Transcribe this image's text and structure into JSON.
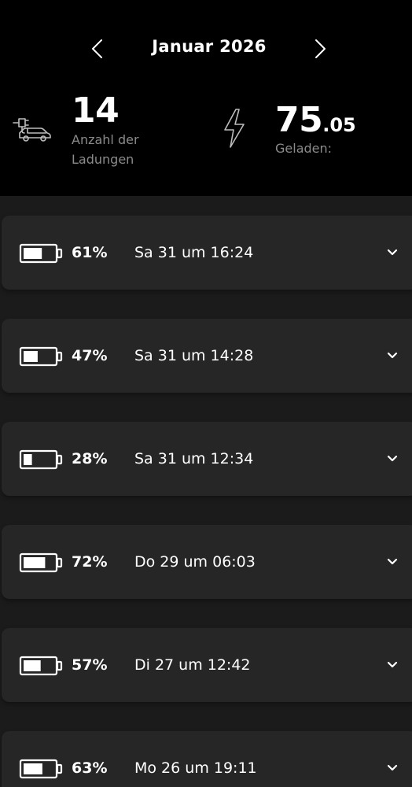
{
  "header": {
    "month_title": "Januar 2026",
    "prev_icon": "chevron-left-icon",
    "next_icon": "chevron-right-icon"
  },
  "stats": {
    "charges_count": "14",
    "charges_label": "Anzahl der Ladungen",
    "charges_icon": "ev-car-plug-icon",
    "energy_value_int": "75",
    "energy_value_dec": ".05",
    "energy_label": "Geladen:",
    "energy_icon": "lightning-bolt-icon"
  },
  "sessions": [
    {
      "percent": "61%",
      "level": 0.61,
      "datetime": "Sa 31 um 16:24"
    },
    {
      "percent": "47%",
      "level": 0.47,
      "datetime": "Sa 31 um 14:28"
    },
    {
      "percent": "28%",
      "level": 0.28,
      "datetime": "Sa 31 um 12:34"
    },
    {
      "percent": "72%",
      "level": 0.72,
      "datetime": "Do 29 um 06:03"
    },
    {
      "percent": "57%",
      "level": 0.57,
      "datetime": "Di 27 um 12:42"
    },
    {
      "percent": "63%",
      "level": 0.63,
      "datetime": "Mo 26 um 19:11"
    }
  ],
  "colors": {
    "header_bg": "#000000",
    "page_bg": "#1b1b1b",
    "card_bg": "#262626",
    "text": "#ffffff",
    "muted_text": "#8b8b8b"
  }
}
